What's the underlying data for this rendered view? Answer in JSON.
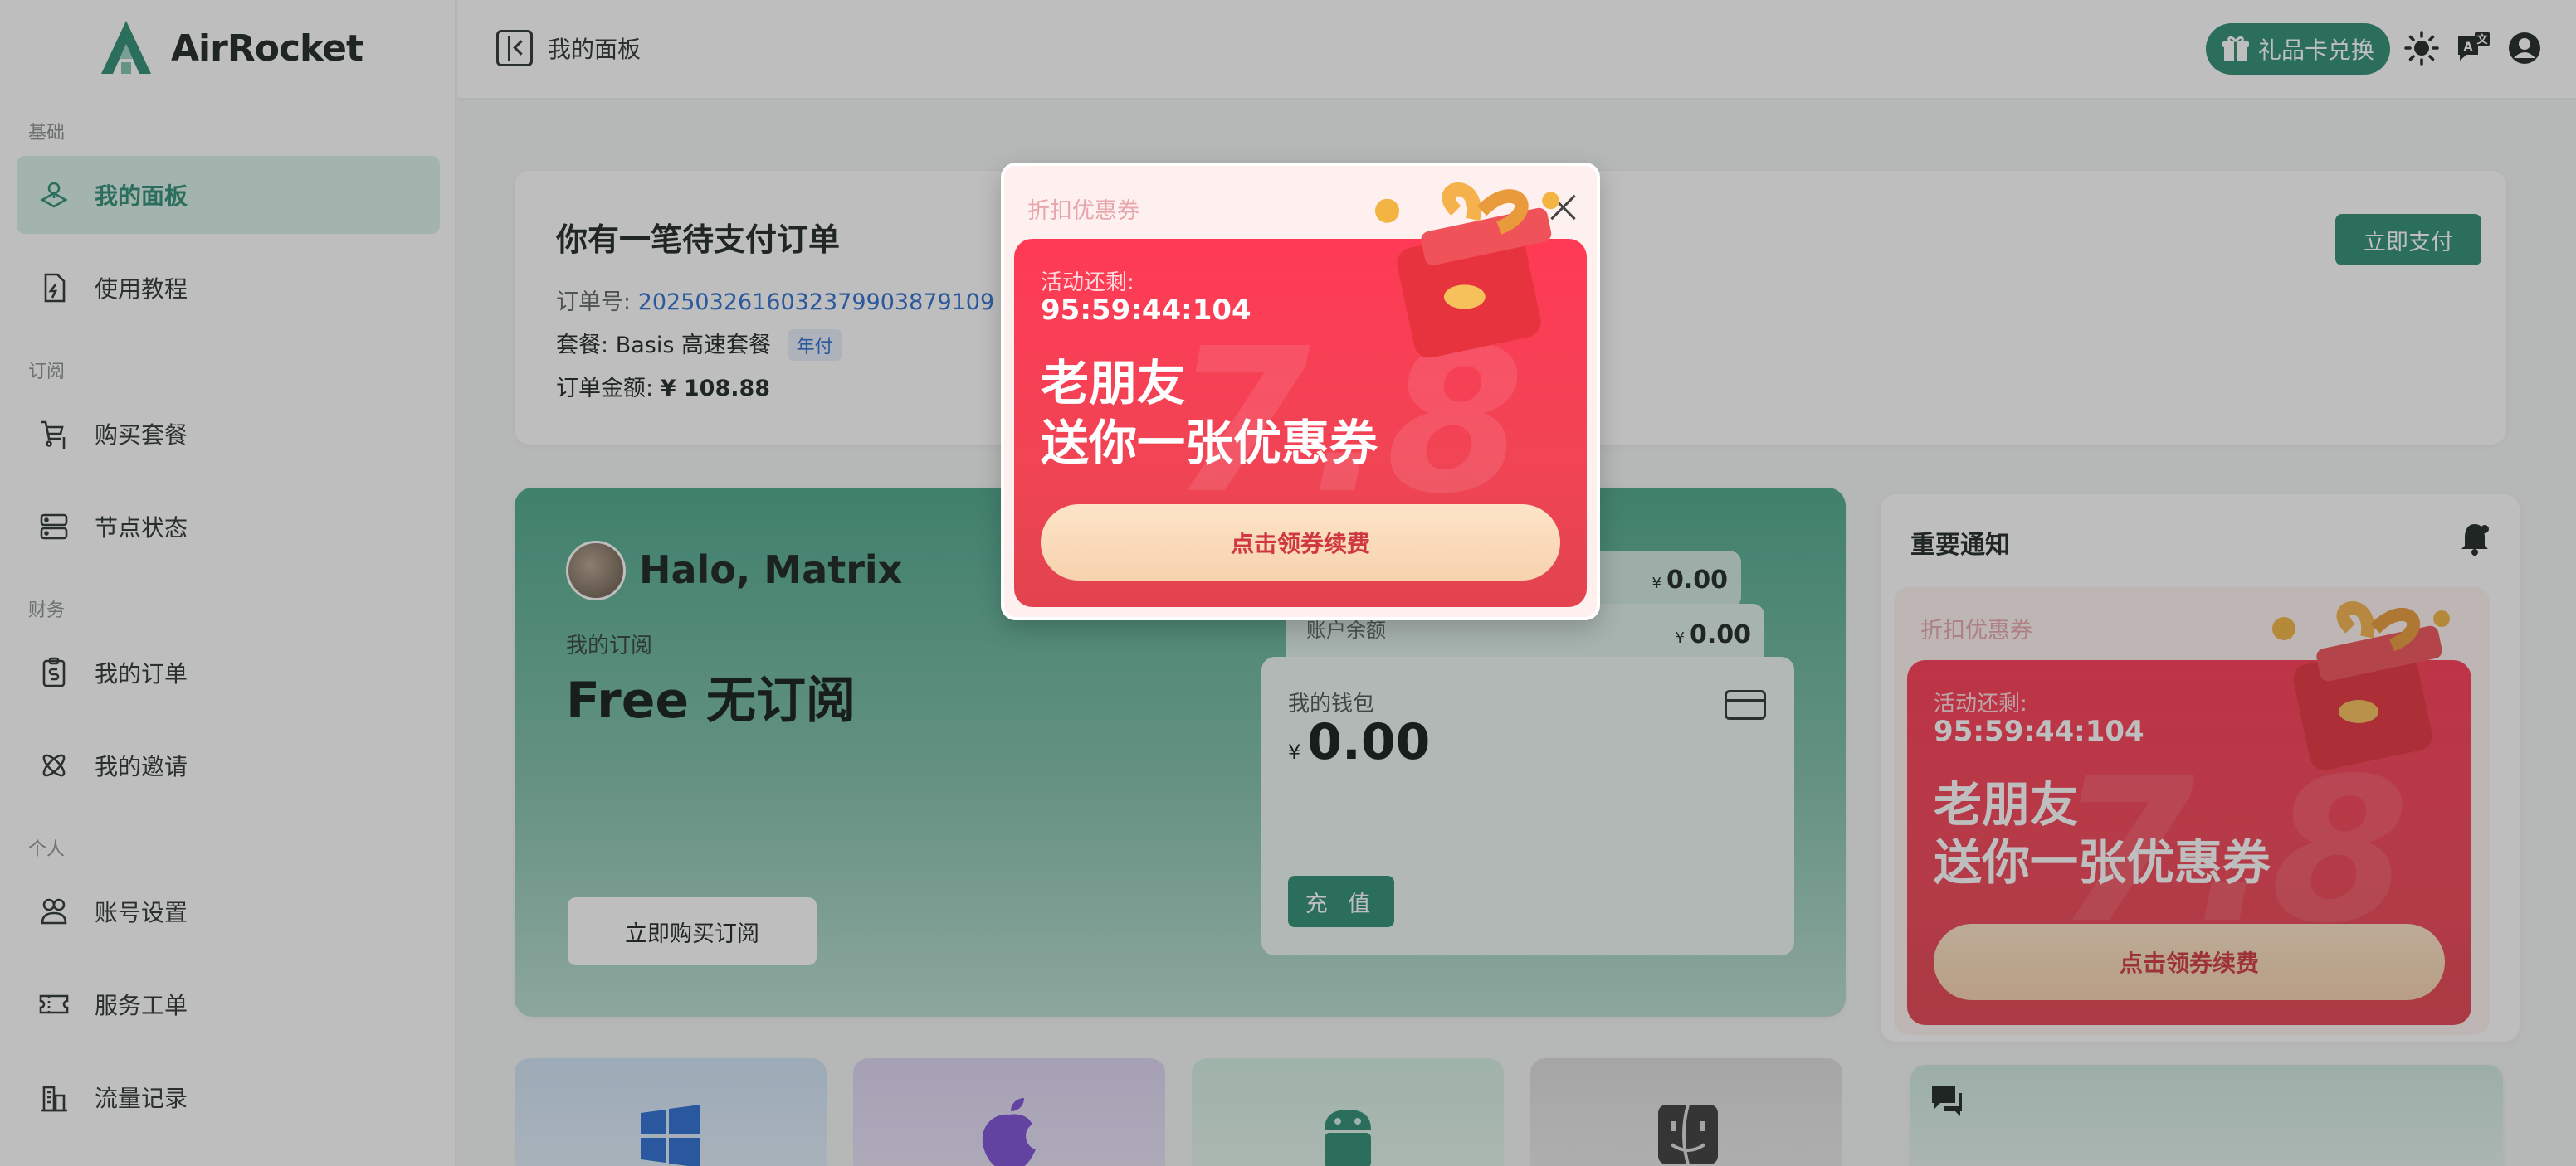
{
  "app": {
    "name": "AirRocket"
  },
  "sidebar": {
    "sections": {
      "basic": "基础",
      "subscribe": "订阅",
      "finance": "财务",
      "personal": "个人"
    },
    "items": [
      {
        "label": "我的面板",
        "icon": "dashboard-icon",
        "active": true
      },
      {
        "label": "使用教程",
        "icon": "document-bolt-icon"
      },
      {
        "label": "购买套餐",
        "icon": "cart-dollar-icon"
      },
      {
        "label": "节点状态",
        "icon": "server-icon"
      },
      {
        "label": "我的订单",
        "icon": "clipboard-dollar-icon"
      },
      {
        "label": "我的邀请",
        "icon": "atom-icon"
      },
      {
        "label": "账号设置",
        "icon": "user-settings-icon"
      },
      {
        "label": "服务工单",
        "icon": "ticket-icon"
      },
      {
        "label": "流量记录",
        "icon": "building-chart-icon"
      }
    ]
  },
  "header": {
    "title": "我的面板",
    "gift_label": "礼品卡兑换",
    "icons": [
      "theme-sun-icon",
      "translate-icon",
      "user-account-icon"
    ]
  },
  "order": {
    "title": "你有一笔待支付订单",
    "order_no_label": "订单号:",
    "order_no": "2025032616032379903879109",
    "plan_label": "套餐:",
    "plan": "Basis 高速套餐",
    "plan_period": "年付",
    "amount_label": "订单金额:",
    "amount": "¥ 108.88",
    "pay_label": "立即支付"
  },
  "subscription": {
    "greeting": "Halo, Matrix",
    "my_sub_label": "我的订阅",
    "my_sub_value": "Free 无订阅",
    "buy_label": "立即购买订阅",
    "stack_top_currency": "¥",
    "stack_top_value": "0.00",
    "balance_label": "账户余额",
    "balance_currency": "¥",
    "balance_value": "0.00",
    "wallet_label": "我的钱包",
    "wallet_currency": "¥",
    "wallet_value": "0.00",
    "recharge_label": "充 值"
  },
  "notice": {
    "title": "重要通知",
    "promo": {
      "head": "折扣优惠券",
      "countdown_label": "活动还剩:",
      "countdown": "95:59:44:104",
      "line1": "老朋友",
      "line2": "送你一张优惠券",
      "button": "点击领券续费"
    }
  },
  "modal": {
    "head": "折扣优惠券",
    "countdown_label": "活动还剩:",
    "countdown": "95:59:44:104",
    "line1": "老朋友",
    "line2": "送你一张优惠券",
    "button": "点击领券续费"
  },
  "colors": {
    "accent": "#2d8d72",
    "promo_red": "#f14455",
    "promo_button": "#f7d2ad"
  }
}
